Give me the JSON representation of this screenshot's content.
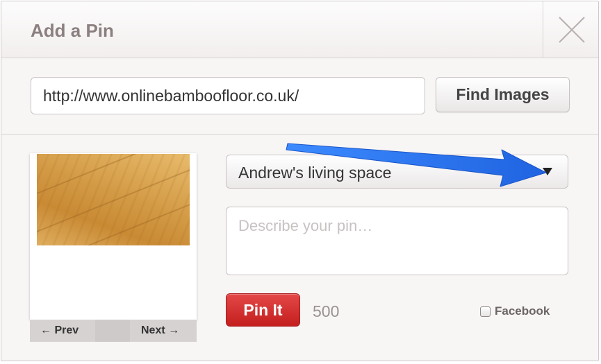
{
  "dialog": {
    "title": "Add a Pin",
    "close_icon": "close-x-icon"
  },
  "url_bar": {
    "value": "http://www.onlinebamboofloor.co.uk/",
    "button_label": "Find Images"
  },
  "preview": {
    "image_icon": "bamboo-floor-image",
    "prev_label": "← Prev",
    "next_label": "Next →"
  },
  "board": {
    "selected": "Andrew's living space",
    "caret_icon": "triangle-down-icon"
  },
  "description": {
    "placeholder": "Describe your pin…",
    "value": ""
  },
  "actions": {
    "pin_label": "Pin It",
    "char_count": "500",
    "facebook_label": "Facebook",
    "facebook_checked": false
  },
  "annotation": {
    "arrow_icon": "blue-pointer-arrow",
    "color": "#2f7cf6"
  },
  "colors": {
    "pin_button": "#cf2a2a",
    "title_text": "#8b7f7f",
    "background": "#f8f5f5"
  }
}
